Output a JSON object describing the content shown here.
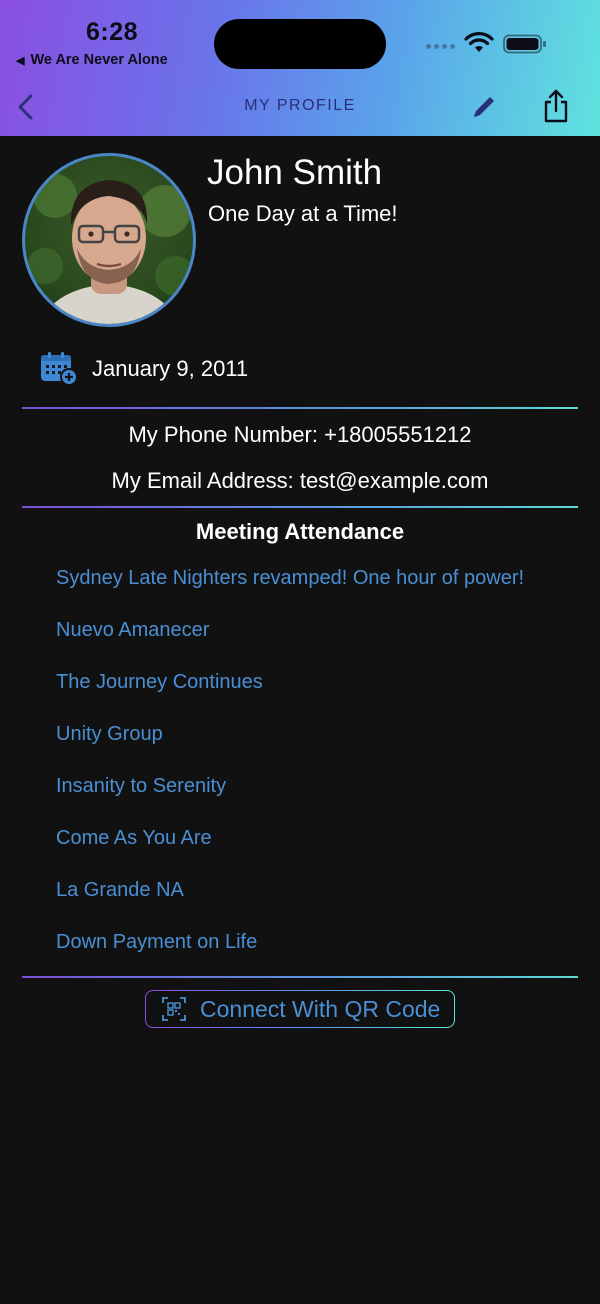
{
  "status_bar": {
    "time": "6:28",
    "back_to_app": "We Are Never Alone"
  },
  "nav": {
    "title": "MY PROFILE"
  },
  "profile": {
    "name": "John Smith",
    "tagline": "One Day at a Time!",
    "date": "January 9, 2011",
    "phone_line": "My Phone Number: +18005551212",
    "email_line": "My Email Address: test@example.com"
  },
  "meetings": {
    "title": "Meeting Attendance",
    "items": [
      "Sydney Late Nighters revamped! One hour of power!",
      "Nuevo Amanecer",
      "The Journey Continues",
      "Unity Group",
      "Insanity to Serenity",
      "Come As You Are",
      "La Grande NA",
      "Down Payment on Life"
    ]
  },
  "qr_button": {
    "label": "Connect With QR Code"
  },
  "colors": {
    "accent_link": "#4a8fd4",
    "background": "#111111",
    "avatar_border": "#4a86c8",
    "nav_title": "#2a2f7a"
  },
  "icons": [
    "back-chevron-icon",
    "pencil-icon",
    "share-icon",
    "calendar-add-icon",
    "qr-code-icon",
    "wifi-icon",
    "battery-icon"
  ]
}
